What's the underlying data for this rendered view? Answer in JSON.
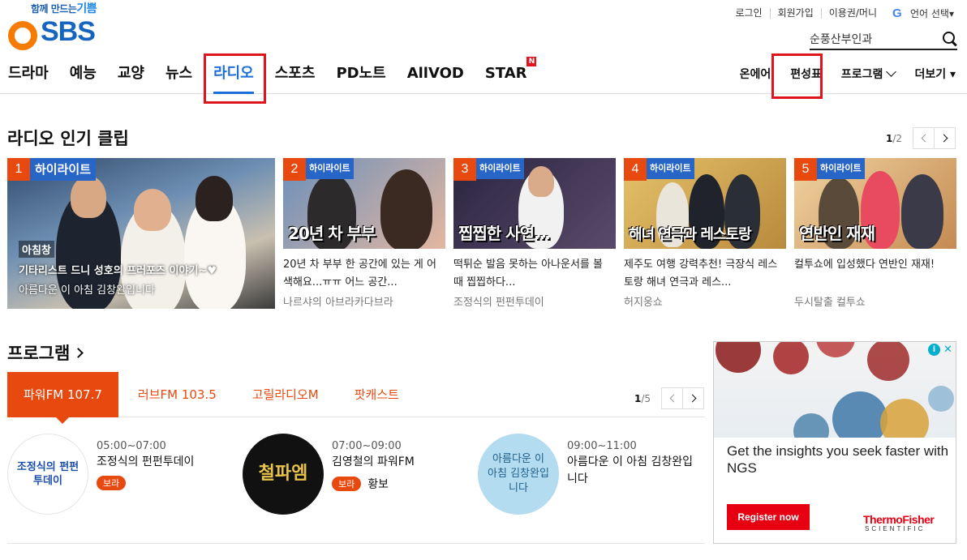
{
  "logo": {
    "tagline_prefix": "함께 만드는",
    "tagline_emph": "기쁨",
    "text": "SBS"
  },
  "top_links": [
    "로그인",
    "회원가입",
    "이용권/머니"
  ],
  "language": {
    "icon": "google-g-icon",
    "label": "언어 선택▾"
  },
  "search": {
    "value": "순풍산부인과",
    "icon": "search-icon"
  },
  "gnb": {
    "items": [
      "드라마",
      "예능",
      "교양",
      "뉴스",
      "라디오",
      "스포츠",
      "PD노트",
      "AllVOD",
      "STAR"
    ],
    "active": "라디오",
    "new_badge": "N",
    "right_items": [
      "온에어",
      "편성표",
      "프로그램",
      "더보기 ▾"
    ]
  },
  "clips_section": {
    "title": "라디오 인기 클립",
    "pager": {
      "current": "1",
      "total": "/2"
    },
    "big_clip": {
      "num": "1",
      "tag": "하이라이트",
      "corner": "아침창",
      "title": "기타리스트 드니 성호의 프러포즈 이야기~♥",
      "sub": "아름다운 이 아침 김창완입니다"
    },
    "clips": [
      {
        "num": "2",
        "tag": "하이라이트",
        "thumb_cap": "20년 차 부부",
        "desc": "20년 차 부부 한 공간에 있는 게 어색해요...ㅠㅠ 어느 공간...",
        "program": "나르샤의 아브라카다브라",
        "bg": "#5b7fa6"
      },
      {
        "num": "3",
        "tag": "하이라이트",
        "thumb_cap": "찝찝한 사연...",
        "desc": "떡튀순 발음 못하는 아나운서를 볼 때 찝찝하다...",
        "program": "조정식의 펀펀투데이",
        "bg": "#3a3350"
      },
      {
        "num": "4",
        "tag": "하이라이트",
        "thumb_cap": "해녀 연극과 레스토랑",
        "desc": "제주도 여행 강력추천! 극장식 레스토랑 해녀 연극과 레스...",
        "program": "허지웅쇼",
        "bg": "#c9a24c"
      },
      {
        "num": "5",
        "tag": "하이라이트",
        "thumb_cap": "연반인 재재",
        "desc": "컬투쇼에 입성했다 연반인 재재!",
        "program": "두시탈출 컬투쇼",
        "bg": "#d9b07a"
      }
    ]
  },
  "program_section": {
    "title": "프로그램",
    "tabs": [
      "파워FM 107.7",
      "러브FM 103.5",
      "고릴라디오M",
      "팟캐스트"
    ],
    "active_tab": "파워FM 107.7",
    "pager": {
      "current": "1",
      "total": "/5"
    },
    "items": [
      {
        "time": "05:00~07:00",
        "name": "조정식의 펀펀투데이",
        "badge": "보라",
        "extra": "",
        "logo_text": "조정식의 펀펀투데이"
      },
      {
        "time": "07:00~09:00",
        "name": "김영철의 파워FM",
        "badge": "보라",
        "extra": "황보",
        "logo_text": "철파엠"
      },
      {
        "time": "09:00~11:00",
        "name": "아름다운 이 아침 김창완입니다",
        "badge": "",
        "extra": "",
        "logo_text": "아름다운 이 아침 김창완입니다"
      }
    ]
  },
  "ad": {
    "headline": "Get the insights you seek faster with NGS",
    "cta": "Register now",
    "brand": "ThermoFisher",
    "brand_sub": "SCIENTIFIC"
  },
  "colors": {
    "accent_orange": "#e8490f",
    "sbs_blue": "#1e6fd9",
    "highlight_red": "#e0141d",
    "tag_blue": "#2765c6"
  }
}
